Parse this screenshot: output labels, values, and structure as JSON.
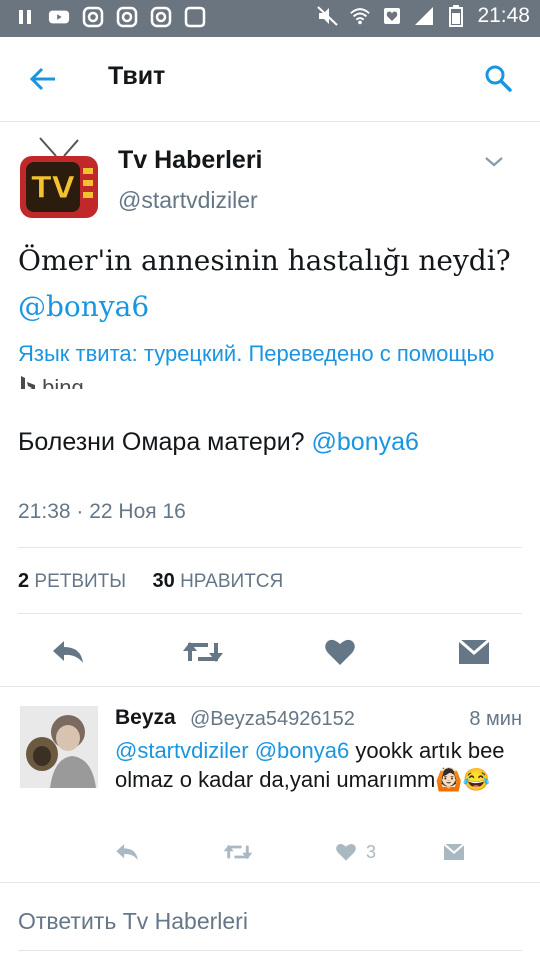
{
  "status_bar": {
    "time": "21:48",
    "left_icons": [
      "pause-icon",
      "youtube-icon",
      "instagram-icon",
      "instagram-icon",
      "instagram-icon",
      "app-icon"
    ],
    "right_icons": [
      "mute-icon",
      "wifi-icon",
      "data-saver-icon",
      "signal-icon",
      "battery-icon"
    ]
  },
  "header": {
    "title": "Твит",
    "back_icon": "arrow-left-icon",
    "search_icon": "search-icon"
  },
  "tweet": {
    "author_name": "Tv Haberleri",
    "author_handle": "@startvdiziler",
    "avatar_text": "TV",
    "text_main": "Ömer'in annesinin hastalığı neydi?",
    "text_mention": "@bonya6",
    "translation_note": "Язык твита: турецкий. Переведено с помощью",
    "translation_provider": "bing",
    "translation_text": "Болезни Омара матери?",
    "translation_mention": "@bonya6",
    "timestamp": "21:38 · 22 Ноя 16",
    "retweet_count": "2",
    "retweet_label": "РЕТВИТЫ",
    "like_count": "30",
    "like_label": "НРАВИТСЯ"
  },
  "reply": {
    "name": "Beyza",
    "handle": "@Beyza54926152",
    "time": "8 мин",
    "mention1": "@startvdiziler",
    "mention2": "@bonya6",
    "text": "yookk artık bee olmaz o kadar da,yani umarıımm🙆🏻😂",
    "like_count": "3"
  },
  "reply_box": {
    "placeholder": "Ответить Tv Haberleri"
  },
  "colors": {
    "accent": "#1b95e0",
    "secondary_text": "#657786",
    "icon_gray": "#657786",
    "status_bar": "#6b7580"
  }
}
